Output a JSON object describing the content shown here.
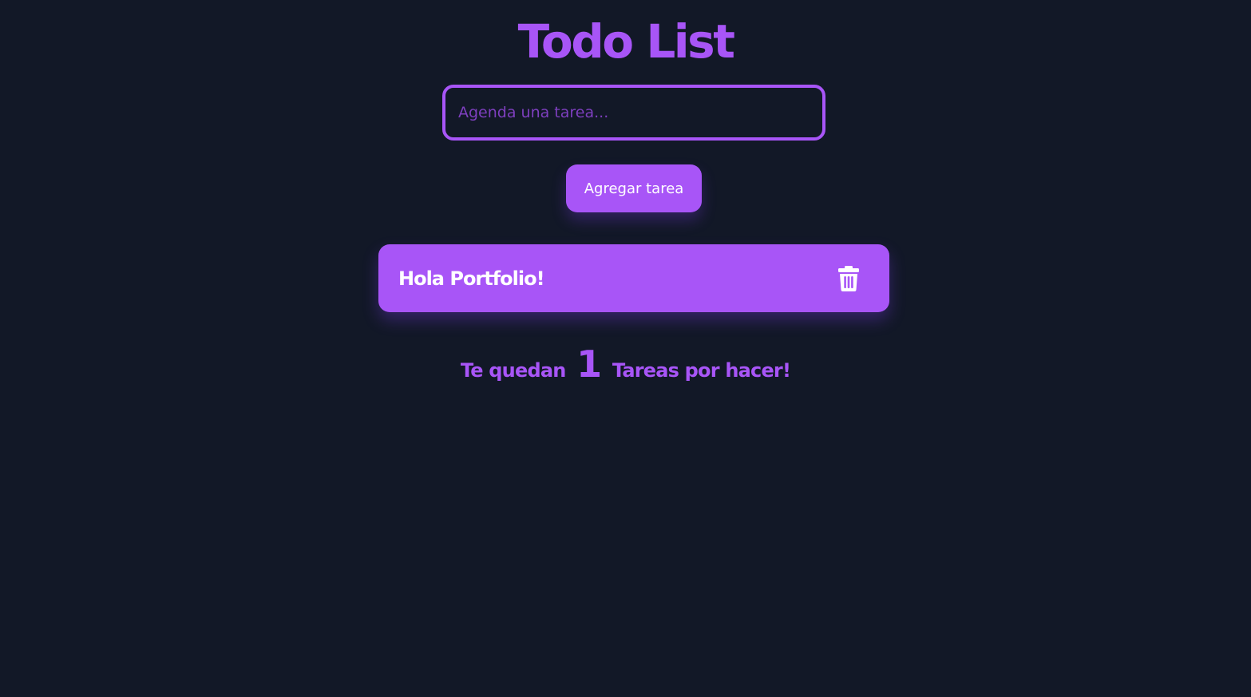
{
  "app": {
    "title": "Todo List"
  },
  "input": {
    "placeholder": "Agenda una tarea...",
    "value": ""
  },
  "add_button": {
    "label": "Agregar tarea"
  },
  "tasks": [
    {
      "text": "Hola Portfolio!",
      "delete_icon": "trash-icon"
    }
  ],
  "remaining": {
    "prefix": "Te quedan",
    "count": "1",
    "suffix": "Tareas por hacer!"
  },
  "colors": {
    "background": "#121827",
    "accent": "#a855f7",
    "task_text": "#ffffff"
  }
}
